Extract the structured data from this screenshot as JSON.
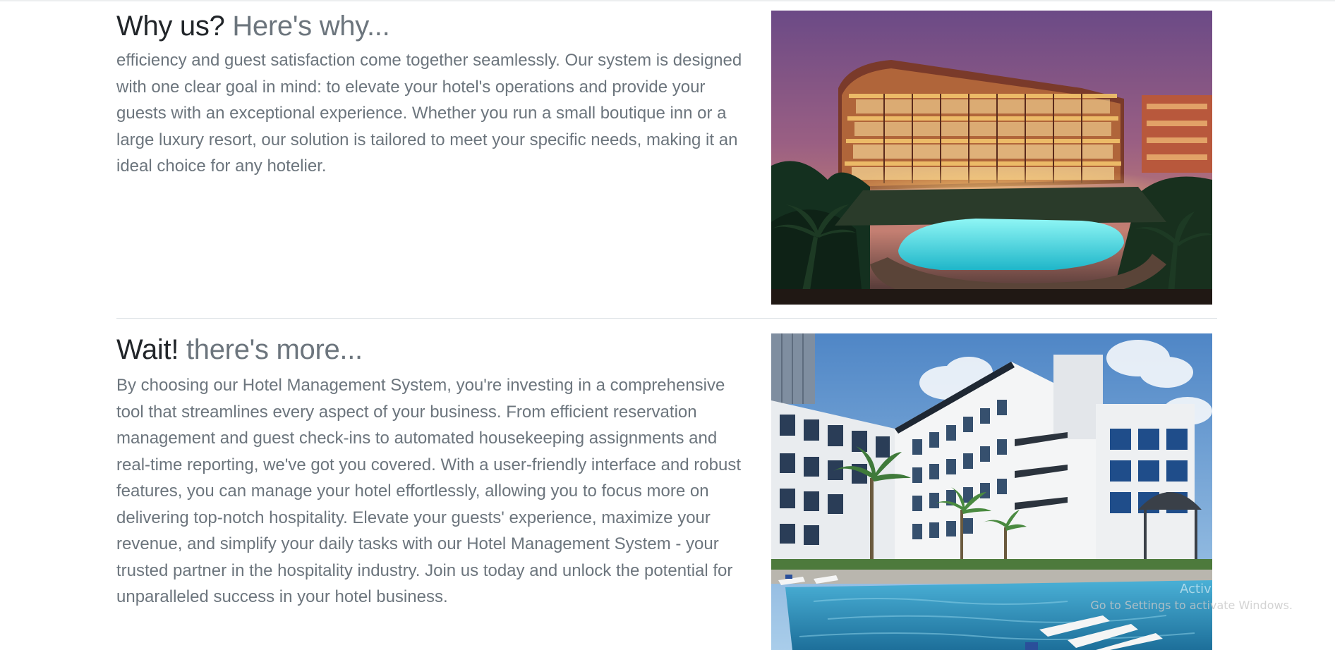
{
  "features": [
    {
      "heading": "Why us?",
      "heading_muted": "Here's why...",
      "body": "efficiency and guest satisfaction come together seamlessly. Our system is designed with one clear goal in mind: to elevate your hotel's operations and provide your guests with an exceptional experience. Whether you run a small boutique inn or a large luxury resort, our solution is tailored to meet your specific needs, making it an ideal choice for any hotelier."
    },
    {
      "heading": "Wait!",
      "heading_muted": "there's more...",
      "body": "By choosing our Hotel Management System, you're investing in a comprehensive tool that streamlines every aspect of your business. From efficient reservation management and guest check-ins to automated housekeeping assignments and real-time reporting, we've got you covered. With a user-friendly interface and robust features, you can manage your hotel effortlessly, allowing you to focus more on delivering top-notch hospitality. Elevate your guests' experience, maximize your revenue, and simplify your daily tasks with our Hotel Management System - your trusted partner in the hospitality industry. Join us today and unlock the potential for unparalleled success in your hotel business."
    }
  ],
  "watermark": {
    "title": "Activate Windows",
    "subtitle": "Go to Settings to activate Windows."
  },
  "colors": {
    "heading": "#212529",
    "muted": "#6c757d",
    "divider": "#dee2e6"
  }
}
